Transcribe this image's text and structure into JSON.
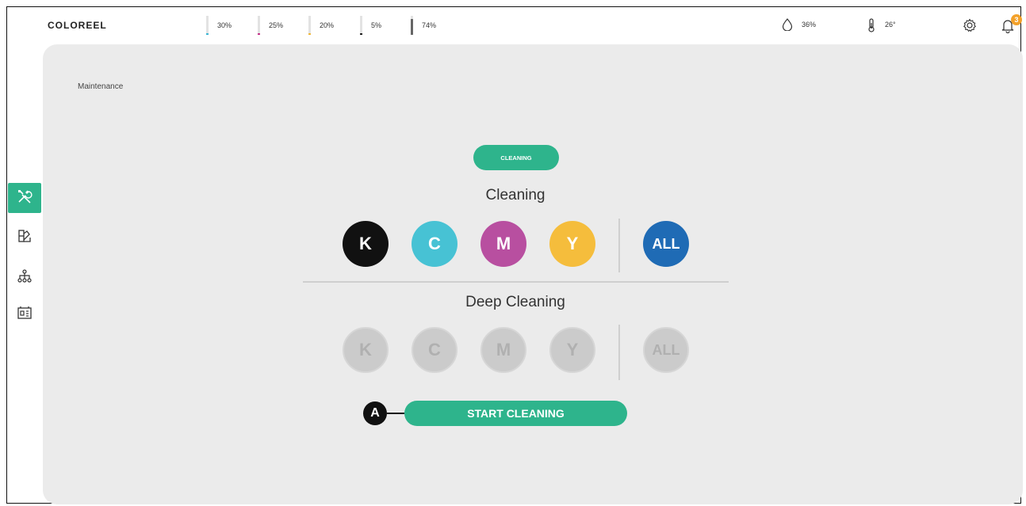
{
  "header": {
    "brand": "COLOREEL",
    "inks": [
      {
        "label": "30%",
        "level": 0.3,
        "color": "#3bb6d4"
      },
      {
        "label": "25%",
        "level": 0.25,
        "color": "#c4348a"
      },
      {
        "label": "20%",
        "level": 0.2,
        "color": "#f0b83a"
      },
      {
        "label": "5%",
        "level": 0.05,
        "color": "#222222"
      },
      {
        "label": "74%",
        "level": 0.74,
        "color": "#666666"
      }
    ],
    "humidity": {
      "icon": "droplet-icon",
      "value": "36%"
    },
    "temperature": {
      "icon": "thermometer-icon",
      "value": "26°"
    },
    "notification_count": "3"
  },
  "sidebar": {
    "items": [
      {
        "name": "maintenance",
        "icon": "tools-icon",
        "active": true
      },
      {
        "name": "colors",
        "icon": "palette-icon",
        "active": false
      },
      {
        "name": "network",
        "icon": "network-icon",
        "active": false
      },
      {
        "name": "jobs",
        "icon": "machine-icon",
        "active": false
      }
    ]
  },
  "main": {
    "breadcrumb": "Maintenance",
    "mode_pill": "CLEANING",
    "cleaning": {
      "title": "Cleaning",
      "buttons": [
        {
          "label": "K",
          "color": "#111111"
        },
        {
          "label": "C",
          "color": "#47c2d4"
        },
        {
          "label": "M",
          "color": "#b84fa0"
        },
        {
          "label": "Y",
          "color": "#f5bd3c"
        },
        {
          "label": "ALL",
          "color": "#1f6bb5"
        }
      ]
    },
    "deep_cleaning": {
      "title": "Deep Cleaning",
      "buttons": [
        {
          "label": "K"
        },
        {
          "label": "C"
        },
        {
          "label": "M"
        },
        {
          "label": "Y"
        },
        {
          "label": "ALL"
        }
      ]
    },
    "start_button": "START CLEANING",
    "callout": "A"
  },
  "colors": {
    "accent": "#2eb48c",
    "panel": "#ebebeb"
  }
}
